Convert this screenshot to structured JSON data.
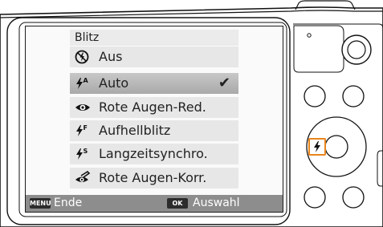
{
  "menu": {
    "title": "Blitz",
    "items": [
      {
        "label": "Aus",
        "icon": "flash-off-icon",
        "selected": false
      },
      {
        "label": "Auto",
        "icon": "flash-auto-icon",
        "selected": true
      },
      {
        "label": "Rote Augen-Red.",
        "icon": "red-eye-reduction-icon",
        "selected": false
      },
      {
        "label": "Aufhellblitz",
        "icon": "fill-in-flash-icon",
        "selected": false
      },
      {
        "label": "Langzeitsynchro.",
        "icon": "slow-sync-icon",
        "selected": false
      },
      {
        "label": "Rote Augen-Korr.",
        "icon": "red-eye-fix-icon",
        "selected": false
      }
    ],
    "check_mark": "✔"
  },
  "bottom_bar": {
    "menu_key": "MENU",
    "menu_label": "Ende",
    "ok_key": "OK",
    "ok_label": "Auswahl"
  },
  "camera": {
    "flash_button_icon": "flash-icon",
    "highlight_color": "#e8851c"
  }
}
